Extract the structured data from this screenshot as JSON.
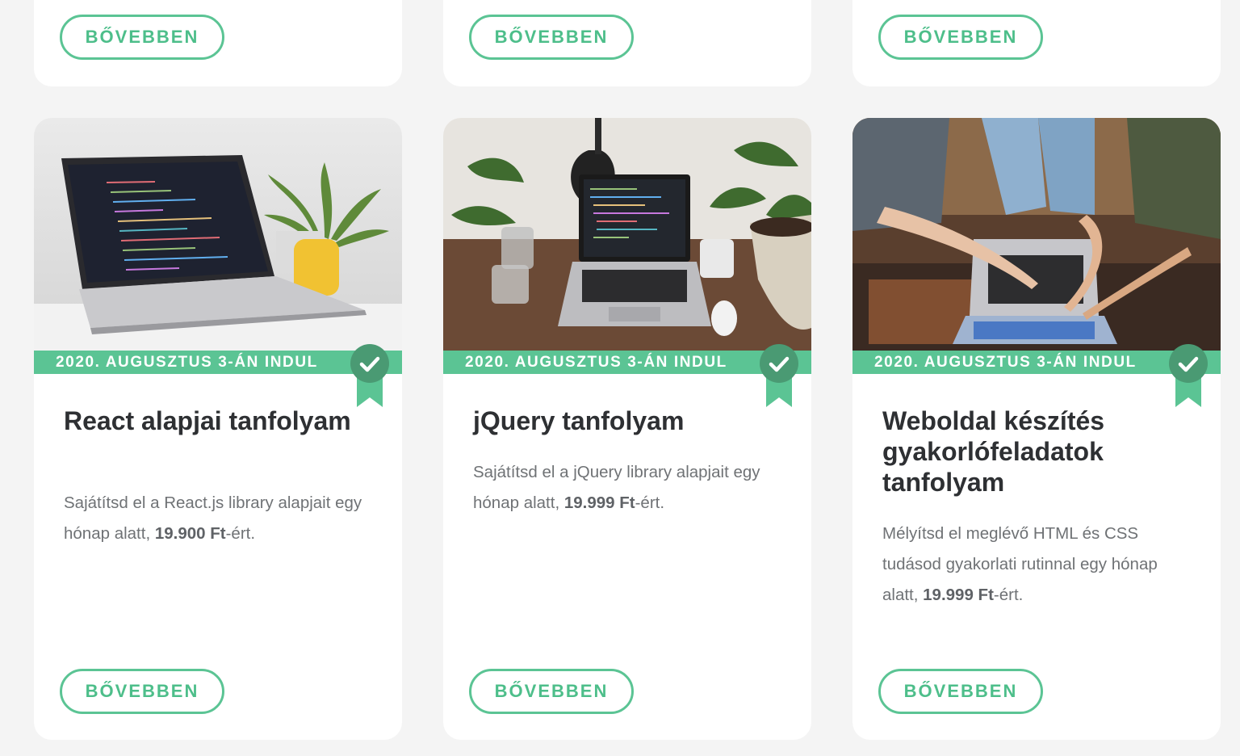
{
  "colors": {
    "accent": "#5bc494",
    "background": "#f4f4f4",
    "card": "#ffffff",
    "title": "#2e3033",
    "text": "#6f7275"
  },
  "top_cards": [
    {
      "button_label": "BŐVEBBEN"
    },
    {
      "button_label": "BŐVEBBEN"
    },
    {
      "button_label": "BŐVEBBEN"
    }
  ],
  "courses": [
    {
      "image_icon": "laptop-code-on-desk-photo",
      "start_label": "2020. AUGUSZTUS 3-ÁN INDUL",
      "title": "React alapjai tanfolyam",
      "desc_before": "Sajátítsd el a React.js library alapjait egy hónap alatt, ",
      "price_number": "19.900",
      "price_currency": "Ft",
      "desc_after": "-ért.",
      "button_label": "BŐVEBBEN"
    },
    {
      "image_icon": "laptop-with-plants-photo",
      "start_label": "2020. AUGUSZTUS 3-ÁN INDUL",
      "title": "jQuery tanfolyam",
      "desc_before": "Sajátítsd el a jQuery library alapjait egy hónap alatt, ",
      "price_number": "19.999",
      "price_currency": "Ft",
      "desc_after": "-ért.",
      "button_label": "BŐVEBBEN"
    },
    {
      "image_icon": "group-pointing-at-laptop-photo",
      "start_label": "2020. AUGUSZTUS 3-ÁN INDUL",
      "title": "Weboldal készítés gyakorlófeladatok tanfolyam",
      "desc_before": "Mélyítsd el meglévő HTML és CSS tudásod gyakorlati rutinnal egy hónap alatt, ",
      "price_number": "19.999",
      "price_currency": "Ft",
      "desc_after": "-ért.",
      "button_label": "BŐVEBBEN"
    }
  ]
}
